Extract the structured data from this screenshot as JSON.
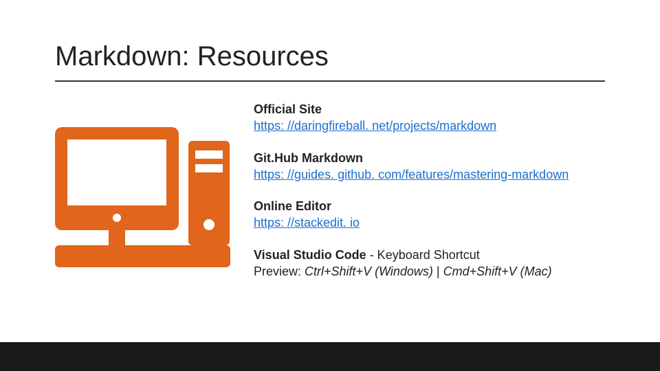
{
  "title": "Markdown: Resources",
  "icon": {
    "name": "computer-icon",
    "color": "#E1651B"
  },
  "resources": {
    "official": {
      "label": "Official Site",
      "url": "https: //daringfireball. net/projects/markdown"
    },
    "github": {
      "label": "Git.Hub Markdown",
      "url": "https: //guides. github. com/features/mastering-markdown"
    },
    "editor": {
      "label": "Online Editor",
      "url": "https: //stackedit. io"
    },
    "vscode": {
      "label": "Visual Studio Code",
      "sub": " - Keyboard Shortcut",
      "preview_prefix": "Preview: ",
      "win": "Ctrl+Shift+V (Windows)",
      "sep": " | ",
      "mac": "Cmd+Shift+V (Mac)"
    }
  }
}
